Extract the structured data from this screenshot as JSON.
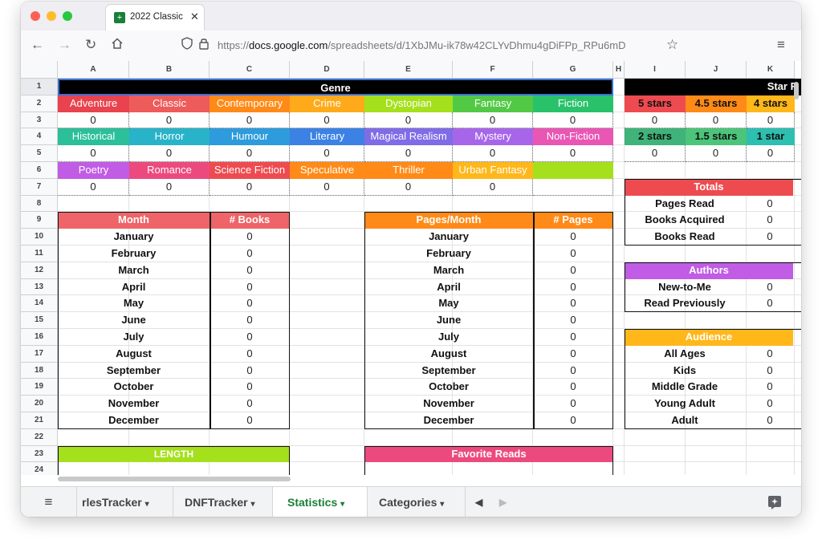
{
  "browser": {
    "tab_title": "2022 Classic",
    "tab_icon": "+",
    "url_prefix": "https://",
    "url_domain": "docs.google.com",
    "url_path": "/spreadsheets/d/1XbJMu-ik78w42CLYvDhmu4gDiFPp_RPu6mD"
  },
  "columns": [
    "A",
    "B",
    "C",
    "D",
    "E",
    "F",
    "G",
    "H",
    "I",
    "J",
    "K"
  ],
  "rows": [
    "1",
    "2",
    "3",
    "4",
    "5",
    "6",
    "7",
    "8",
    "9",
    "10",
    "11",
    "12",
    "13",
    "14",
    "15",
    "16",
    "17",
    "18",
    "19",
    "20",
    "21",
    "22",
    "23",
    "24"
  ],
  "genre": {
    "header": "Genre",
    "row2": [
      "Adventure",
      "Classic",
      "Contemporary",
      "Crime",
      "Dystopian",
      "Fantasy",
      "Fiction"
    ],
    "row3": [
      "0",
      "0",
      "0",
      "0",
      "0",
      "0",
      "0"
    ],
    "row4": [
      "Historical",
      "Horror",
      "Humour",
      "Literary",
      "Magical Realism",
      "Mystery",
      "Non-Fiction"
    ],
    "row5": [
      "0",
      "0",
      "0",
      "0",
      "0",
      "0",
      "0"
    ],
    "row6": [
      "Poetry",
      "Romance",
      "Science Fiction",
      "Speculative",
      "Thriller",
      "Urban Fantasy",
      ""
    ],
    "row7": [
      "0",
      "0",
      "0",
      "0",
      "0",
      "0",
      ""
    ],
    "colors": [
      "#e8434e",
      "#ee5b5b",
      "#ff8a17",
      "#ffaa1a",
      "#a4e01c",
      "#52c945",
      "#29c26b",
      "#2bbf9a",
      "#29b3c9",
      "#2d9bdc",
      "#3b82e4",
      "#7f6ce6",
      "#a766ea",
      "#e956b4",
      "#c15ce5",
      "#ec4a7e",
      "#ee4b50",
      "#ff8a17",
      "#ff8a17",
      "#ffb71a",
      "#a4e01c"
    ]
  },
  "stars": {
    "header": "Star R",
    "row2": [
      "5 stars",
      "4.5 stars",
      "4 stars"
    ],
    "row3": [
      "0",
      "0",
      "0"
    ],
    "row4": [
      "2 stars",
      "1.5 stars",
      "1 star"
    ],
    "row5": [
      "0",
      "0",
      "0"
    ]
  },
  "month_books": {
    "month_header": "Month",
    "count_header": "# Books",
    "months": [
      "January",
      "February",
      "March",
      "April",
      "May",
      "June",
      "July",
      "August",
      "September",
      "October",
      "November",
      "December"
    ],
    "values": [
      "0",
      "0",
      "0",
      "0",
      "0",
      "0",
      "0",
      "0",
      "0",
      "0",
      "0",
      "0"
    ]
  },
  "pages_month": {
    "month_header": "Pages/Month",
    "count_header": "# Pages",
    "months": [
      "January",
      "February",
      "March",
      "April",
      "May",
      "June",
      "July",
      "August",
      "September",
      "October",
      "November",
      "December"
    ],
    "values": [
      "0",
      "0",
      "0",
      "0",
      "0",
      "0",
      "0",
      "0",
      "0",
      "0",
      "0",
      "0"
    ]
  },
  "totals": {
    "header": "Totals",
    "labels": [
      "Pages Read",
      "Books Acquired",
      "Books Read"
    ],
    "values": [
      "0",
      "0",
      "0"
    ]
  },
  "authors": {
    "header": "Authors",
    "labels": [
      "New-to-Me",
      "Read Previously"
    ],
    "values": [
      "0",
      "0"
    ]
  },
  "audience": {
    "header": "Audience",
    "labels": [
      "All Ages",
      "Kids",
      "Middle Grade",
      "Young Adult",
      "Adult"
    ],
    "values": [
      "0",
      "0",
      "0",
      "0",
      "0"
    ]
  },
  "length": {
    "header": "LENGTH"
  },
  "favorites": {
    "header": "Favorite Reads"
  },
  "sheets": {
    "tabs": [
      "rlesTracker",
      "DNFTracker",
      "Statistics",
      "Categories"
    ],
    "active": "Statistics"
  }
}
